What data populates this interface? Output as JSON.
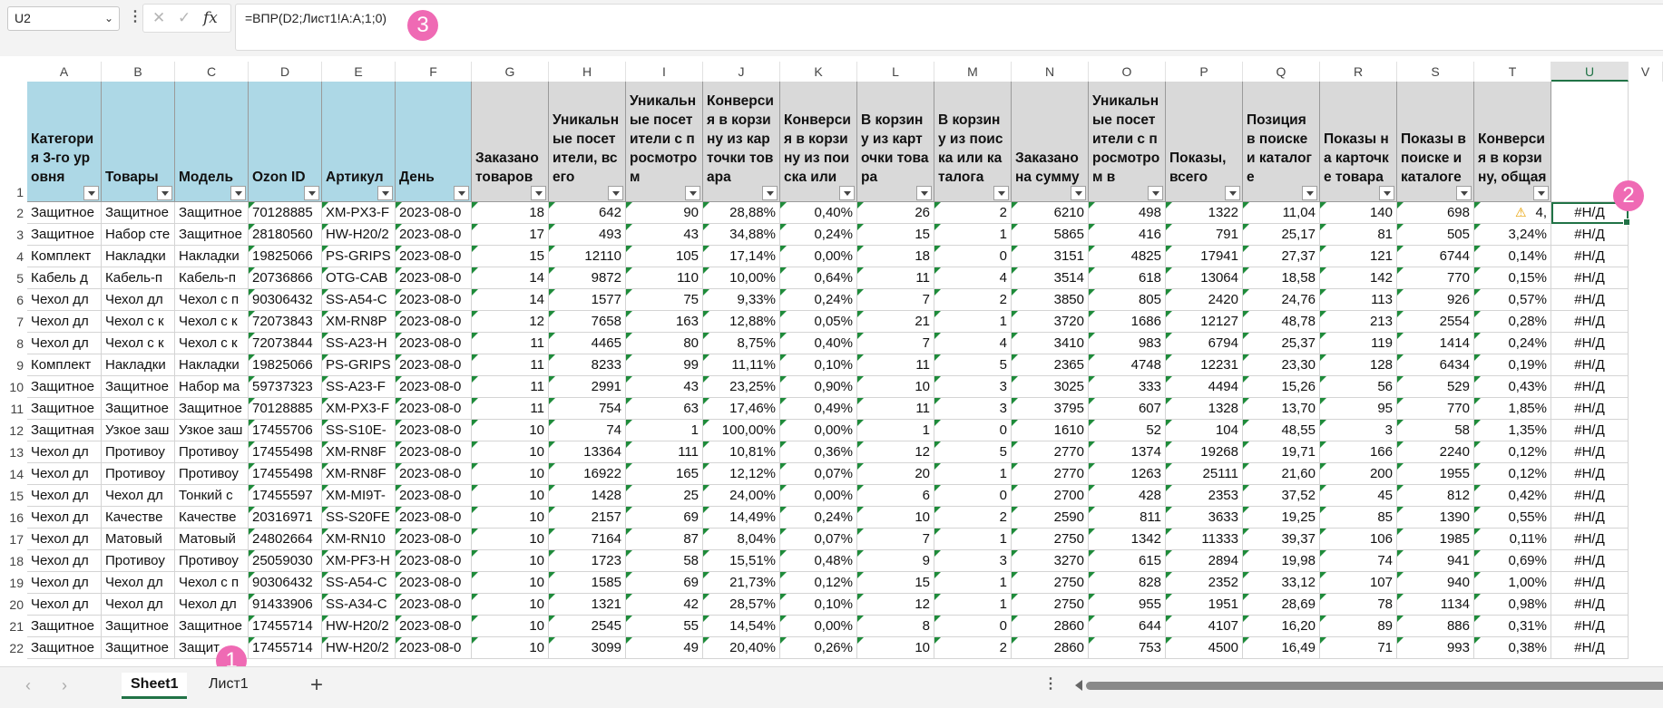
{
  "namebox": {
    "value": "U2"
  },
  "formula": {
    "text": "=ВПР(D2;Лист1!A:A;1;0)",
    "fx_label": "fx"
  },
  "markers": [
    "1",
    "2",
    "3"
  ],
  "columns": [
    "A",
    "B",
    "C",
    "D",
    "E",
    "F",
    "G",
    "H",
    "I",
    "J",
    "K",
    "L",
    "M",
    "N",
    "O",
    "P",
    "Q",
    "R",
    "S",
    "T",
    "U",
    "V"
  ],
  "headers": [
    "Категория 3-го уровня",
    "Товары",
    "Модель",
    "Ozon ID",
    "Артикул",
    "День",
    "Заказано товаров",
    "Уникальные посетители, всего",
    "Уникальные посетители с просмотром",
    "Конверсия в корзину из карточки товара",
    "Конверсия в корзину из поиска или",
    "В корзину из карточки товара",
    "В корзину из поиска или каталога",
    "Заказано на сумму",
    "Уникальные посетители с просмотром в",
    "Показы, всего",
    "Позиция в поиске и каталоге",
    "Показы на карточке товара",
    "Показы в поиске и каталоге",
    "Конверсия в корзину, общая",
    ""
  ],
  "rows": [
    [
      "2",
      "Защитное",
      "Защитное",
      "Защитное",
      "70128885",
      "XM-PX3-F",
      "2023-08-0",
      "18",
      "642",
      "90",
      "28,88%",
      "0,40%",
      "26",
      "2",
      "6210",
      "498",
      "1322",
      "11,04",
      "140",
      "698",
      "4,",
      "#Н/Д"
    ],
    [
      "3",
      "Защитное",
      "Набор сте",
      "Защитное",
      "28180560",
      "HW-H20/2",
      "2023-08-0",
      "17",
      "493",
      "43",
      "34,88%",
      "0,24%",
      "15",
      "1",
      "5865",
      "416",
      "791",
      "25,17",
      "81",
      "505",
      "3,24%",
      "#Н/Д"
    ],
    [
      "4",
      "Комплект",
      "Накладки",
      "Накладки",
      "19825066",
      "PS-GRIPS",
      "2023-08-0",
      "15",
      "12110",
      "105",
      "17,14%",
      "0,00%",
      "18",
      "0",
      "3151",
      "4825",
      "17941",
      "27,37",
      "121",
      "6744",
      "0,14%",
      "#Н/Д"
    ],
    [
      "5",
      "Кабель д",
      "Кабель-п",
      "Кабель-п",
      "20736866",
      "OTG-CAB",
      "2023-08-0",
      "14",
      "9872",
      "110",
      "10,00%",
      "0,64%",
      "11",
      "4",
      "3514",
      "618",
      "13064",
      "18,58",
      "142",
      "770",
      "0,15%",
      "#Н/Д"
    ],
    [
      "6",
      "Чехол дл",
      "Чехол дл",
      "Чехол с п",
      "90306432",
      "SS-A54-C",
      "2023-08-0",
      "14",
      "1577",
      "75",
      "9,33%",
      "0,24%",
      "7",
      "2",
      "3850",
      "805",
      "2420",
      "24,76",
      "113",
      "926",
      "0,57%",
      "#Н/Д"
    ],
    [
      "7",
      "Чехол дл",
      "Чехол с к",
      "Чехол с к",
      "72073843",
      "XM-RN8P",
      "2023-08-0",
      "12",
      "7658",
      "163",
      "12,88%",
      "0,05%",
      "21",
      "1",
      "3720",
      "1686",
      "12127",
      "48,78",
      "213",
      "2554",
      "0,28%",
      "#Н/Д"
    ],
    [
      "8",
      "Чехол дл",
      "Чехол с к",
      "Чехол с к",
      "72073844",
      "SS-A23-H",
      "2023-08-0",
      "11",
      "4465",
      "80",
      "8,75%",
      "0,40%",
      "7",
      "4",
      "3410",
      "983",
      "6794",
      "25,37",
      "119",
      "1414",
      "0,24%",
      "#Н/Д"
    ],
    [
      "9",
      "Комплект",
      "Накладки",
      "Накладки",
      "19825066",
      "PS-GRIPS",
      "2023-08-0",
      "11",
      "8233",
      "99",
      "11,11%",
      "0,10%",
      "11",
      "5",
      "2365",
      "4748",
      "12231",
      "23,30",
      "128",
      "6434",
      "0,19%",
      "#Н/Д"
    ],
    [
      "10",
      "Защитное",
      "Защитное",
      "Набор ма",
      "59737323",
      "SS-A23-F",
      "2023-08-0",
      "11",
      "2991",
      "43",
      "23,25%",
      "0,90%",
      "10",
      "3",
      "3025",
      "333",
      "4494",
      "15,26",
      "56",
      "529",
      "0,43%",
      "#Н/Д"
    ],
    [
      "11",
      "Защитное",
      "Защитное",
      "Защитное",
      "70128885",
      "XM-PX3-F",
      "2023-08-0",
      "11",
      "754",
      "63",
      "17,46%",
      "0,49%",
      "11",
      "3",
      "3795",
      "607",
      "1328",
      "13,70",
      "95",
      "770",
      "1,85%",
      "#Н/Д"
    ],
    [
      "12",
      "Защитная",
      "Узкое заш",
      "Узкое заш",
      "17455706",
      "SS-S10E-",
      "2023-08-0",
      "10",
      "74",
      "1",
      "100,00%",
      "0,00%",
      "1",
      "0",
      "1610",
      "52",
      "104",
      "48,55",
      "3",
      "58",
      "1,35%",
      "#Н/Д"
    ],
    [
      "13",
      "Чехол дл",
      "Противоу",
      "Противоу",
      "17455498",
      "XM-RN8F",
      "2023-08-0",
      "10",
      "13364",
      "111",
      "10,81%",
      "0,36%",
      "12",
      "5",
      "2770",
      "1374",
      "19268",
      "19,71",
      "166",
      "2240",
      "0,12%",
      "#Н/Д"
    ],
    [
      "14",
      "Чехол дл",
      "Противоу",
      "Противоу",
      "17455498",
      "XM-RN8F",
      "2023-08-0",
      "10",
      "16922",
      "165",
      "12,12%",
      "0,07%",
      "20",
      "1",
      "2770",
      "1263",
      "25111",
      "21,60",
      "200",
      "1955",
      "0,12%",
      "#Н/Д"
    ],
    [
      "15",
      "Чехол дл",
      "Чехол дл",
      "Тонкий с",
      "17455597",
      "XM-MI9T-",
      "2023-08-0",
      "10",
      "1428",
      "25",
      "24,00%",
      "0,00%",
      "6",
      "0",
      "2700",
      "428",
      "2353",
      "37,52",
      "45",
      "812",
      "0,42%",
      "#Н/Д"
    ],
    [
      "16",
      "Чехол дл",
      "Качестве",
      "Качестве",
      "20316971",
      "SS-S20FE",
      "2023-08-0",
      "10",
      "2157",
      "69",
      "14,49%",
      "0,24%",
      "10",
      "2",
      "2590",
      "811",
      "3633",
      "19,25",
      "85",
      "1390",
      "0,55%",
      "#Н/Д"
    ],
    [
      "17",
      "Чехол дл",
      "Матовый",
      "Матовый",
      "24802664",
      "XM-RN10",
      "2023-08-0",
      "10",
      "7164",
      "87",
      "8,04%",
      "0,07%",
      "7",
      "1",
      "2750",
      "1342",
      "11333",
      "39,37",
      "106",
      "1985",
      "0,11%",
      "#Н/Д"
    ],
    [
      "18",
      "Чехол дл",
      "Противоу",
      "Противоу",
      "25059030",
      "XM-PF3-H",
      "2023-08-0",
      "10",
      "1723",
      "58",
      "15,51%",
      "0,48%",
      "9",
      "3",
      "3270",
      "615",
      "2894",
      "19,98",
      "74",
      "941",
      "0,69%",
      "#Н/Д"
    ],
    [
      "19",
      "Чехол дл",
      "Чехол дл",
      "Чехол с п",
      "90306432",
      "SS-A54-C",
      "2023-08-0",
      "10",
      "1585",
      "69",
      "21,73%",
      "0,12%",
      "15",
      "1",
      "2750",
      "828",
      "2352",
      "33,12",
      "107",
      "940",
      "1,00%",
      "#Н/Д"
    ],
    [
      "20",
      "Чехол дл",
      "Чехол дл",
      "Чехол дл",
      "91433906",
      "SS-A34-C",
      "2023-08-0",
      "10",
      "1321",
      "42",
      "28,57%",
      "0,10%",
      "12",
      "1",
      "2750",
      "955",
      "1951",
      "28,69",
      "78",
      "1134",
      "0,98%",
      "#Н/Д"
    ],
    [
      "21",
      "Защитное",
      "Защитное",
      "Защитное",
      "17455714",
      "HW-H20/2",
      "2023-08-0",
      "10",
      "2545",
      "55",
      "14,54%",
      "0,00%",
      "8",
      "0",
      "2860",
      "644",
      "4107",
      "16,20",
      "89",
      "886",
      "0,31%",
      "#Н/Д"
    ],
    [
      "22",
      "Защитное",
      "Защитное",
      "Защит",
      "17455714",
      "HW-H20/2",
      "2023-08-0",
      "10",
      "3099",
      "49",
      "20,40%",
      "0,26%",
      "10",
      "2",
      "2860",
      "753",
      "4500",
      "16,49",
      "71",
      "993",
      "0,38%",
      "#Н/Д"
    ]
  ],
  "row1_label": "1",
  "tabs": [
    "Sheet1",
    "Лист1"
  ],
  "add_sheet": "+",
  "colors": {
    "header_blue": "#add8e6",
    "header_gray": "#d9d9d9",
    "accent": "#217346",
    "marker": "#ef6ab4"
  }
}
